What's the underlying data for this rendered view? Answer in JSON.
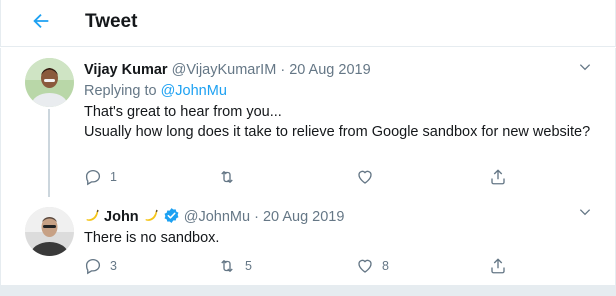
{
  "header": {
    "title": "Tweet"
  },
  "tweet1": {
    "name": "Vijay Kumar",
    "handle": "@VijayKumarIM",
    "separator": "·",
    "date": "20 Aug 2019",
    "replying_prefix": "Replying to",
    "replying_handle": "@JohnMu",
    "text_line1": "That's great to hear from you...",
    "text_line2": "Usually how long does it take to relieve from Google sandbox for new website?",
    "reply_count": "1",
    "retweet_count": "",
    "like_count": ""
  },
  "tweet2": {
    "name": "John",
    "handle": "@JohnMu",
    "separator": "·",
    "date": "20 Aug 2019",
    "text": "There is no sandbox.",
    "reply_count": "3",
    "retweet_count": "5",
    "like_count": "8"
  },
  "icons": {
    "back": "arrow-left-icon",
    "more": "chevron-down-icon",
    "reply": "comment-icon",
    "retweet": "retweet-icon",
    "like": "heart-icon",
    "share": "share-icon",
    "verified": "verified-badge-icon",
    "name_emoji": "banana-emoji-icon"
  },
  "colors": {
    "accent": "#1da1f2",
    "muted": "#657786",
    "text": "#14171a",
    "border": "#e6ecf0"
  }
}
